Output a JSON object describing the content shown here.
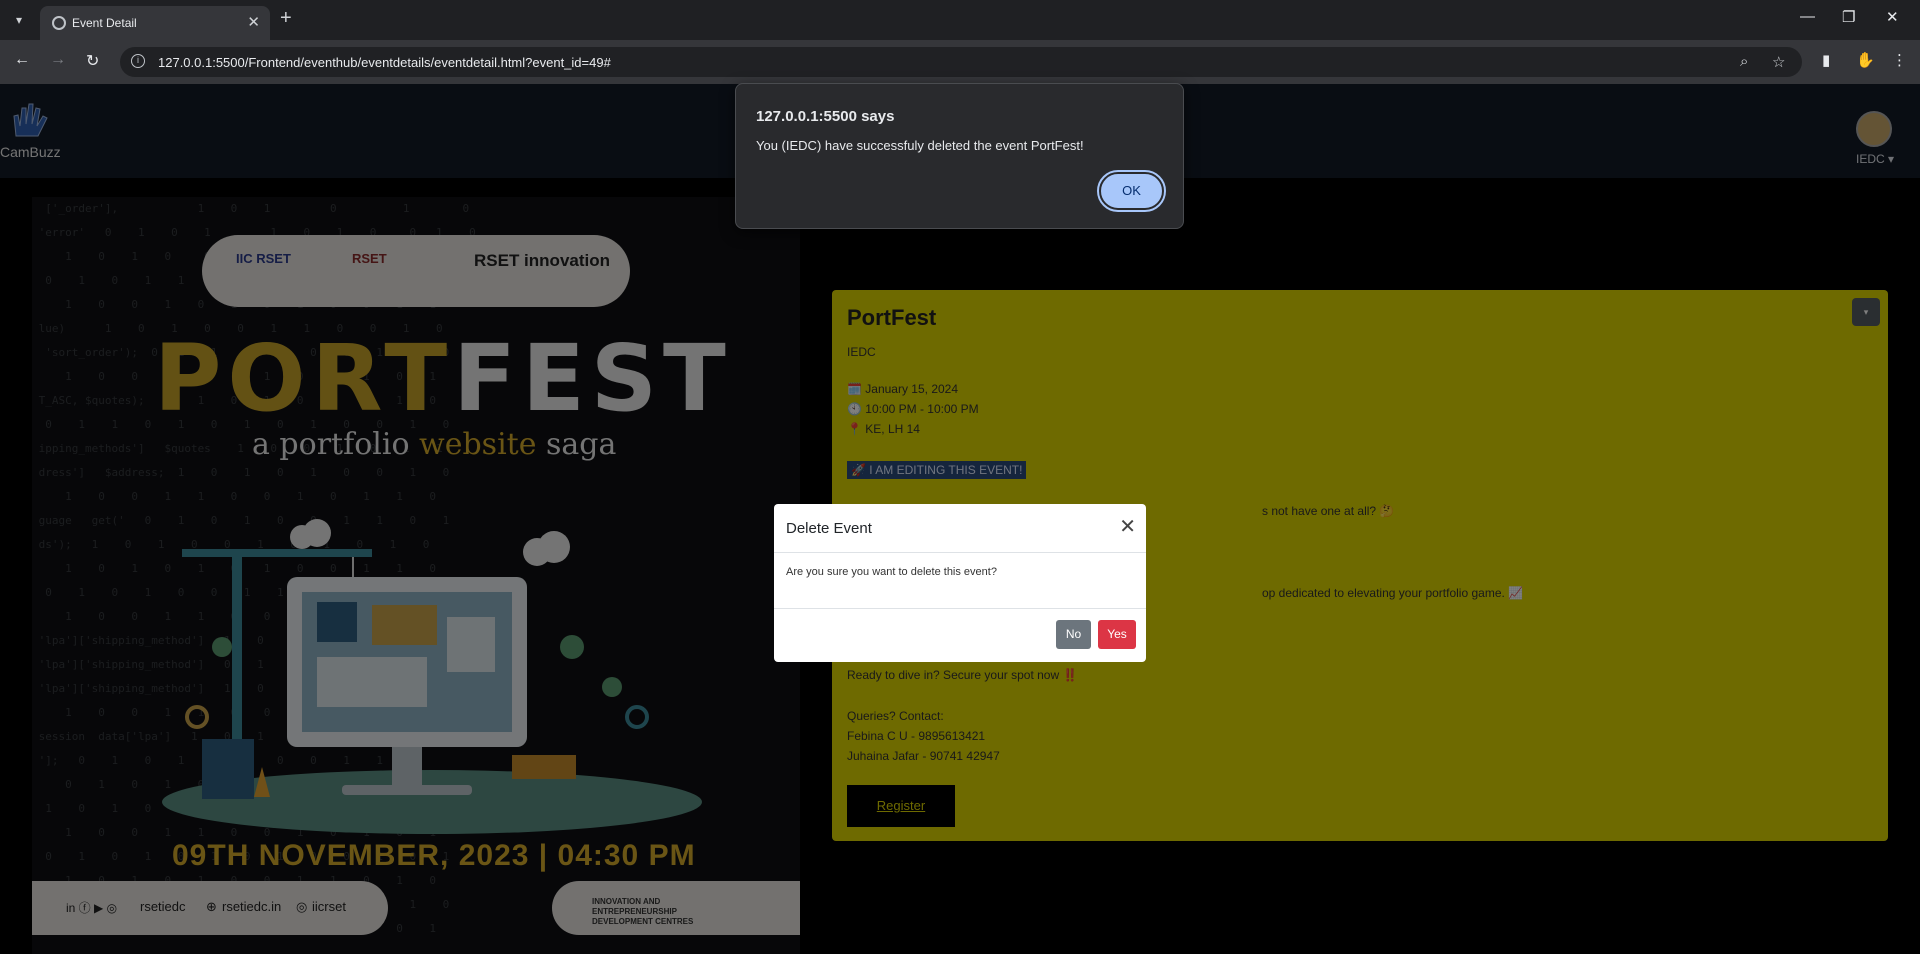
{
  "browser": {
    "tab_title": "Event Detail",
    "url": "127.0.0.1:5500/Frontend/eventhub/eventdetails/eventdetail.html?event_id=49#"
  },
  "navbar": {
    "brand": "CamBuzz",
    "user": "IEDC ▾"
  },
  "poster": {
    "logo_1": "IIC RSET",
    "logo_2": "RSET",
    "logo_3": "RSET innovation",
    "title_port": "PORT",
    "title_fest": "FEST",
    "subtitle_pre": "a portfolio ",
    "subtitle_hl": "website",
    "subtitle_post": " saga",
    "date": "09TH NOVEMBER, 2023 | 04:30 PM",
    "social_handle": "rsetiedc",
    "website": "rsetiedc.in",
    "insta": "iicrset",
    "footer_right": "INNOVATION AND ENTREPRENEURSHIP DEVELOPMENT CENTRES"
  },
  "event": {
    "title": "PortFest",
    "organizer": "IEDC",
    "date": "🗓️ January 15, 2024",
    "time": "🕙 10:00 PM - 10:00 PM",
    "location": "📍 KE, LH 14",
    "highlight": "🚀 I AM EDITING THIS EVENT!",
    "desc_1": "s not have one at all? 🤔",
    "desc_2": "op dedicated to elevating your portfolio game. 📈",
    "cta": "Ready to dive in? Secure your spot now ‼️",
    "contact_heading": "Queries? Contact:",
    "contact_1": "Febina C U - 9895613421",
    "contact_2": "Juhaina Jafar -  90741 42947",
    "register_label": "Register"
  },
  "modal": {
    "title": "Delete Event",
    "body": "Are you sure you want to delete this event?",
    "no_label": "No",
    "yes_label": "Yes"
  },
  "alert": {
    "title": "127.0.0.1:5500 says",
    "message": "You (IEDC) have successfuly deleted the event PortFest!",
    "ok_label": "OK"
  },
  "colors": {
    "card_bg": "#ddd400",
    "poster_gold": "#c7a229",
    "danger": "#dc3545",
    "secondary": "#6c757d"
  }
}
